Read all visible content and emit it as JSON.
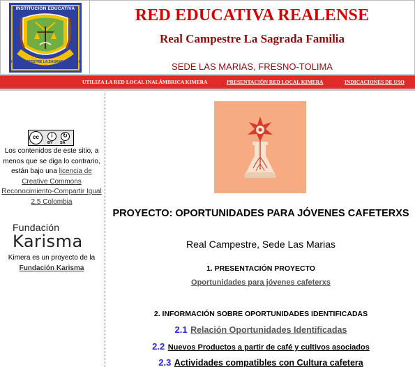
{
  "header": {
    "logo": {
      "top_text": "INSTITUCIÓN EDUCATIVA",
      "bottom_text": "REAL CAMPESTRE LA SAGRADA FAMILIA"
    },
    "title": "RED EDUCATIVA REALENSE",
    "subtitle": "Real Campestre La Sagrada Familia",
    "location": "SEDE LAS MARIAS, FRESNO-TOLIMA"
  },
  "nav": {
    "items": [
      {
        "label": "UTILIZA LA RED LOCAL INALÁMBRICA KIMERA",
        "link": false
      },
      {
        "label": "PRESENTACIÓN RED LOCAL KIMERA",
        "link": true
      },
      {
        "label": "INDICACIONES DE USO",
        "link": true
      }
    ]
  },
  "sidebar": {
    "cc_badge": {
      "cc": "cc",
      "by": "BY",
      "sa": "SA"
    },
    "cc_text_before": "Los contenidos de este sitio, a menos que se diga lo contrario, están bajo una ",
    "cc_link": "licencia de Creative Commons Reconocimiento-Compartir Igual 2.5 Colombia",
    "fundacion_small": "Fundación",
    "fundacion_big": "Karisma",
    "kimera_text_before": "Kimera es un proyecto de la ",
    "kimera_link": "Fundación Karisma"
  },
  "main": {
    "project_title": "PROYECTO:  OPORTUNIDADES PARA JÓVENES CAFETERXS",
    "project_subtitle": "Real Campestre,  Sede Las Marias",
    "section1_title": "1. PRESENTACIÓN PROYECTO",
    "section1_link": "Oportunidades para jóvenes cafeterxs",
    "section2_title": "2. INFORMACIÓN SOBRE OPORTUNIDADES IDENTIFICADAS",
    "items": [
      {
        "number": "2.1",
        "label": "Relación Oportunidades Identificadas"
      },
      {
        "number": "2.2",
        "label": "Nuevos Productos a partir de café y cultivos asociados"
      },
      {
        "number": "2.3",
        "label": "Actividades compatibles con Cultura cafetera"
      }
    ]
  },
  "colors": {
    "title_red": "#d40000",
    "subtitle_maroon": "#8b0e0e",
    "navbar_red": "#e02b2b",
    "item_number_blue": "#2a2acb",
    "image_background": "#f6ab82"
  }
}
